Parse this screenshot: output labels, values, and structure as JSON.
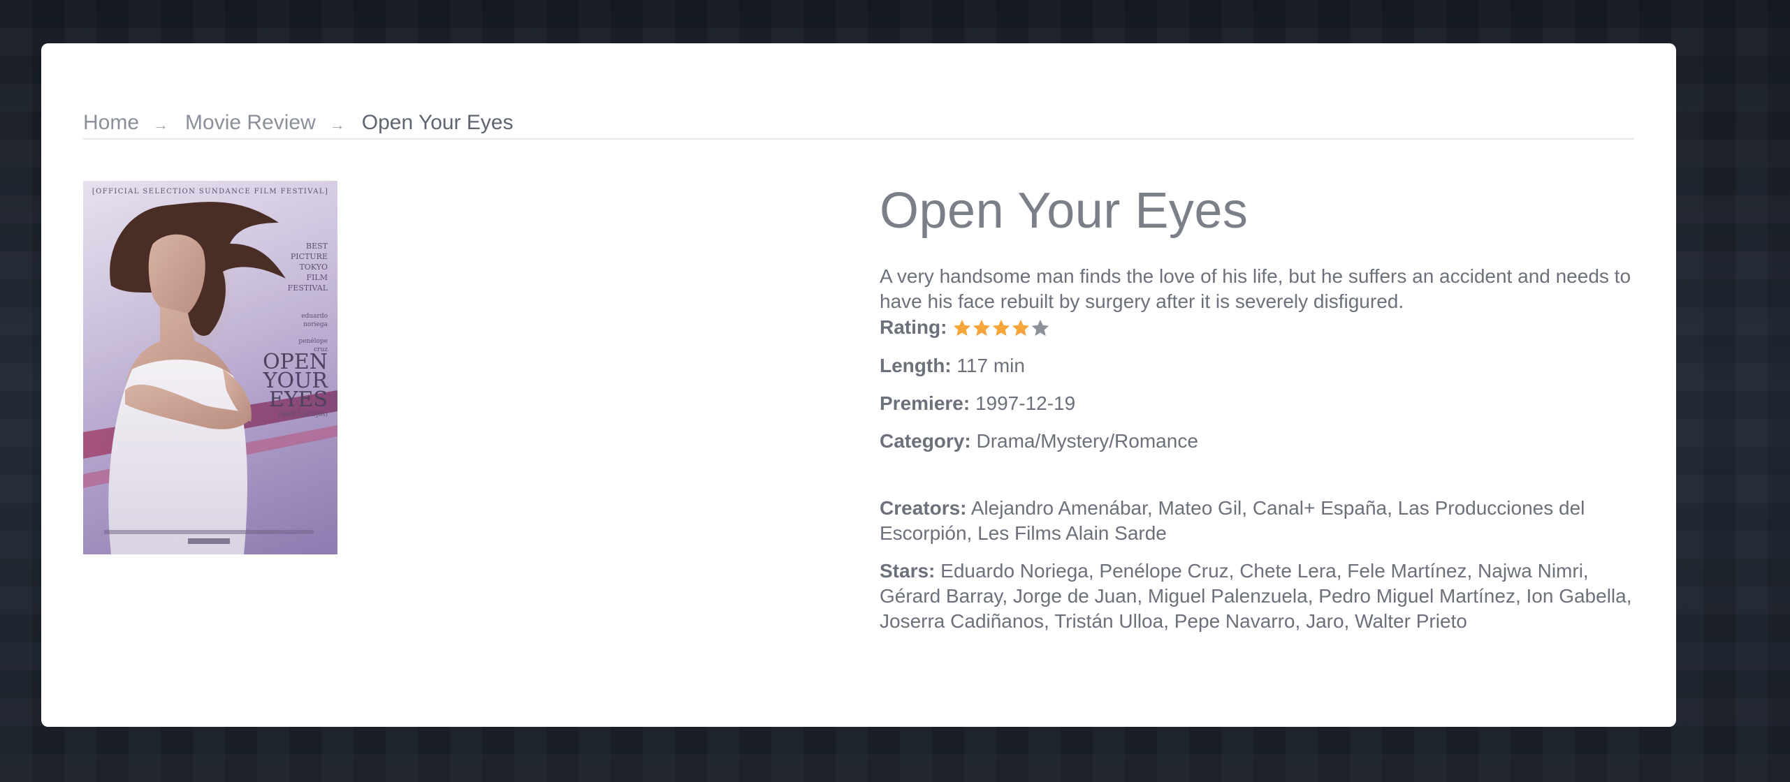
{
  "breadcrumb": {
    "items": [
      "Home",
      "Movie Review"
    ],
    "separator": "→",
    "current": "Open Your Eyes"
  },
  "poster": {
    "festival_line": "[OFFICIAL SELECTION SUNDANCE FILM FESTIVAL]",
    "award": "BEST\nPICTURE\nTOKYO\nFILM\nFESTIVAL",
    "names": "eduardo\nnoriega\n\npenélope\ncruz",
    "title": "OPEN\nYOUR\nEYES",
    "subtitle": "(Abre Los Ojos)"
  },
  "movie": {
    "title": "Open Your Eyes",
    "description": "A very handsome man finds the love of his life, but he suffers an accident and needs to have his face rebuilt by surgery after it is severely disfigured.",
    "rating_label": "Rating:",
    "rating": 4,
    "rating_max": 5,
    "length_label": "Length:",
    "length": "117 min",
    "premiere_label": "Premiere:",
    "premiere": "1997-12-19",
    "category_label": "Category:",
    "category": "Drama/Mystery/Romance",
    "creators_label": "Creators:",
    "creators": "Alejandro Amenábar, Mateo Gil, Canal+ España, Las Producciones del Escorpión, Les Films Alain Sarde",
    "stars_label": "Stars:",
    "stars": "Eduardo Noriega, Penélope Cruz, Chete Lera, Fele Martínez, Najwa Nimri, Gérard Barray, Jorge de Juan, Miguel Palenzuela, Pedro Miguel Martínez, Ion Gabella, Joserra Cadiñanos, Tristán Ulloa, Pepe Navarro, Jaro, Walter Prieto"
  },
  "colors": {
    "star_filled": "#f5a53a",
    "star_empty": "#8b9099",
    "page_background": "#1b212b",
    "card_background": "#ffffff"
  },
  "icons": {
    "breadcrumb_separator": "arrow-right-icon",
    "rating": "star-icon"
  }
}
